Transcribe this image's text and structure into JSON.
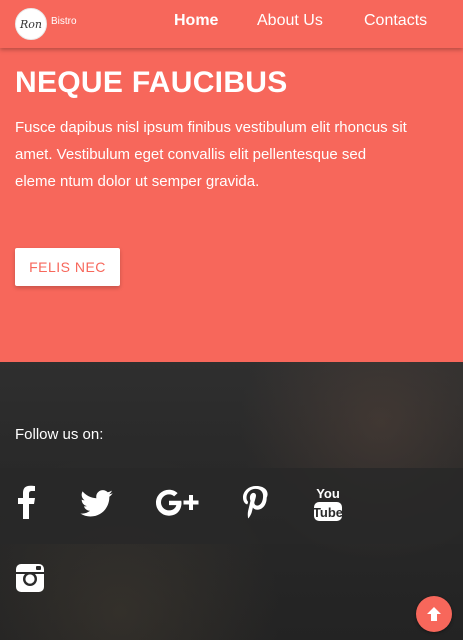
{
  "brand": {
    "logo_text": "Ron",
    "name": "Bistro"
  },
  "nav": {
    "items": [
      {
        "label": "Home",
        "active": true
      },
      {
        "label": "About Us",
        "active": false
      },
      {
        "label": "Contacts",
        "active": false
      }
    ]
  },
  "hero": {
    "title": "NEQUE FAUCIBUS",
    "text": "Fusce dapibus nisl ipsum finibus vestibulum elit rhoncus sit amet. Vestibulum eget convallis elit pellentesque sed eleme ntum dolor ut semper gravida.",
    "button_label": "FELIS NEC"
  },
  "footer": {
    "follow_label": "Follow us on:",
    "social": [
      "facebook-icon",
      "twitter-icon",
      "google-plus-icon",
      "pinterest-icon",
      "youtube-icon",
      "instagram-icon"
    ]
  },
  "colors": {
    "accent": "#f7675b",
    "footer_bg": "#2a2a2a",
    "text_light": "#ffffff"
  }
}
